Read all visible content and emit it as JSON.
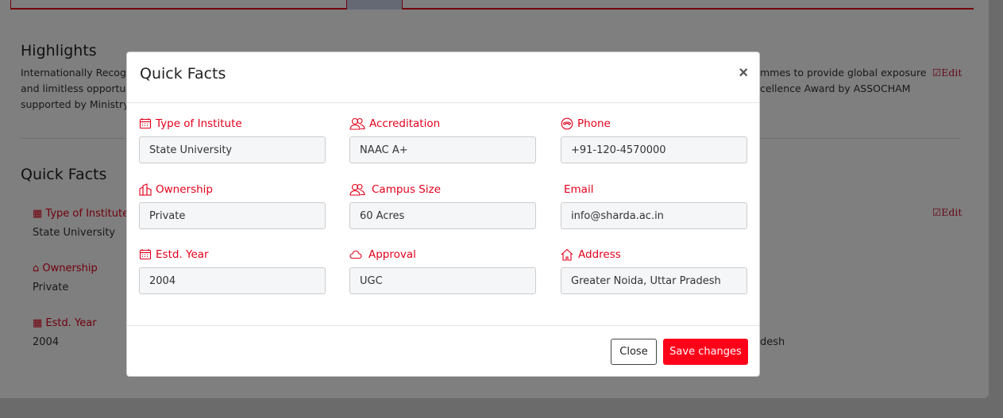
{
  "background": {
    "highlights_title": "Highlights",
    "highlights_line1_left": "Internationally Recogn",
    "highlights_line1_right": "mmes to provide global exposure",
    "highlights_line2_left": "and limitless opportun",
    "highlights_line2_right": "cellence Award by ASSOCHAM",
    "highlights_line3_left": "supported by Ministry",
    "edit_label": "Edit",
    "quick_facts_title": "Quick Facts",
    "facts": [
      {
        "label": "Type of Institute",
        "value": "State University"
      },
      {
        "label": "Ownership",
        "value": "Private"
      },
      {
        "label": "Estd. Year",
        "value": "2004"
      }
    ],
    "address_fragment": "desh"
  },
  "modal": {
    "title": "Quick Facts",
    "close_symbol": "×",
    "fields": [
      {
        "label": "Type of Institute",
        "value": "State University",
        "icon": "calendar-icon"
      },
      {
        "label": "Accreditation",
        "value": "NAAC A+",
        "icon": "users-icon"
      },
      {
        "label": "Phone",
        "value": "+91-120-4570000",
        "icon": "phone-icon"
      },
      {
        "label": "Ownership",
        "value": "Private",
        "icon": "building-icon"
      },
      {
        "label": "Campus Size",
        "value": "60 Acres",
        "icon": "users-icon"
      },
      {
        "label": "Email",
        "value": "info@sharda.ac.in",
        "icon": ""
      },
      {
        "label": "Estd. Year",
        "value": "2004",
        "icon": "calendar-icon"
      },
      {
        "label": "Approval",
        "value": "UGC",
        "icon": "cloud-icon"
      },
      {
        "label": "Address",
        "value": "Greater Noida, Uttar Pradesh",
        "icon": "home-icon"
      }
    ],
    "close_button": "Close",
    "save_button": "Save changes"
  },
  "colors": {
    "accent": "#e3001b",
    "save_button": "#ff0019"
  }
}
